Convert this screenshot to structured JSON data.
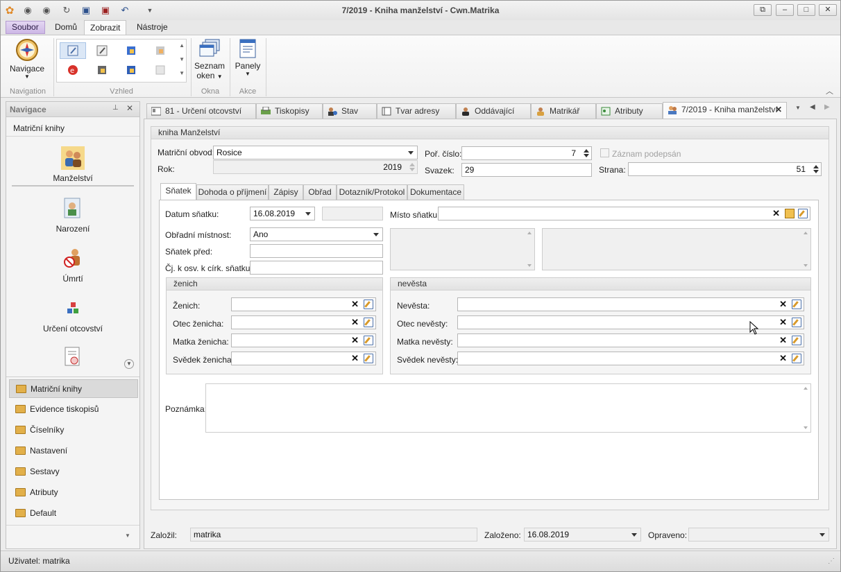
{
  "window": {
    "title": "7/2019 - Kniha manželství - Cwn.Matrika",
    "controls": [
      "restore",
      "minimize",
      "maximize",
      "close"
    ]
  },
  "ribbon": {
    "tabs": [
      "Soubor",
      "Domů",
      "Zobrazit",
      "Nástroje"
    ],
    "active_tab": "Zobrazit",
    "navigace_label": "Navigace",
    "seznam_label": "Seznam",
    "oken_label": "oken",
    "panely_label": "Panely",
    "group_navigation": "Navigation",
    "group_vzhled": "Vzhled",
    "group_okna": "Okna",
    "group_akce": "Akce"
  },
  "nav": {
    "header": "Navigace",
    "section": "Matriční knihy",
    "big_items": [
      "Manželství",
      "Narození",
      "Úmrtí",
      "Určení otcovství"
    ],
    "folders": [
      "Matriční knihy",
      "Evidence tiskopisů",
      "Číselníky",
      "Nastavení",
      "Sestavy",
      "Atributy",
      "Default"
    ]
  },
  "doc_tabs": [
    "81 - Určení otcovství",
    "Tiskopisy",
    "Stav",
    "Tvar adresy",
    "Oddávající",
    "Matrikář",
    "Atributy",
    "7/2019 - Kniha manželství"
  ],
  "form": {
    "group_title": "kniha Manželství",
    "matricni_obvod_label": "Matriční obvod:",
    "matricni_obvod_value": "Rosice",
    "rok_label": "Rok:",
    "rok_value": "2019",
    "por_cislo_label": "Poř. číslo:",
    "por_cislo_value": "7",
    "svazek_label": "Svazek:",
    "svazek_value": "29",
    "zaznam_label": "Záznam podepsán",
    "strana_label": "Strana:",
    "strana_value": "51",
    "tabs": [
      "Sňatek",
      "Dohoda o příjmení",
      "Zápisy",
      "Obřad",
      "Dotazník/Protokol",
      "Dokumentace"
    ],
    "datum_label": "Datum sňatku:",
    "datum_value": "16.08.2019",
    "misto_label": "Místo sňatku:",
    "obradni_label": "Obřadní místnost:",
    "obradni_value": "Ano",
    "snatek_pred_label": "Sňatek před:",
    "cj_label": "Čj. k osv. k círk. sňatku:",
    "zenich_group": "ženich",
    "zenich_rows": [
      "Ženich:",
      "Otec ženicha:",
      "Matka ženicha:",
      "Svědek ženicha:"
    ],
    "nevesta_group": "nevěsta",
    "nevesta_rows": [
      "Nevěsta:",
      "Otec nevěsty:",
      "Matka nevěsty:",
      "Svědek nevěsty:"
    ],
    "poznamka_label": "Poznámka:"
  },
  "footer": {
    "zalozil_label": "Založil:",
    "zalozil_value": "matrika",
    "zalozeno_label": "Založeno:",
    "zalozeno_value": "16.08.2019",
    "opraveno_label": "Opraveno:"
  },
  "status": {
    "user": "Uživatel: matrika"
  }
}
